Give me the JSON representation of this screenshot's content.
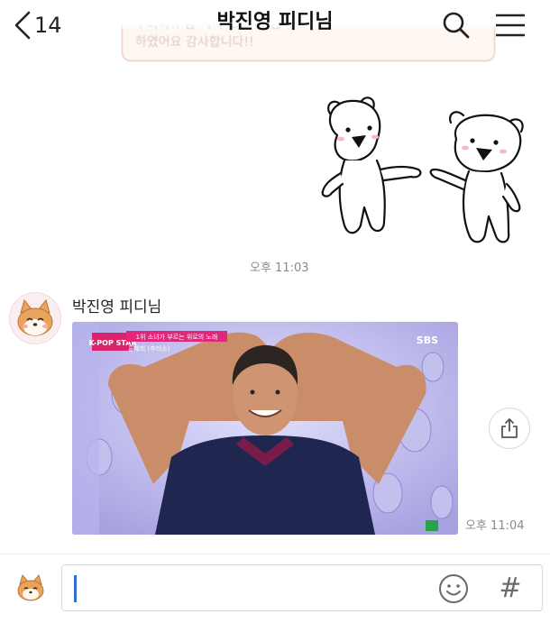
{
  "header": {
    "back_count": "14",
    "title": "박진영 피디님",
    "icons": [
      "chevron-left-icon",
      "search-icon",
      "menu-icon"
    ]
  },
  "notice": {
    "line1": "우와아!! 감     서서 오늘 참 감      주",
    "line2": "하였어요 감사합니다!!"
  },
  "messages": {
    "sticker_time": "오후 11:03",
    "friend": {
      "sender": "박진영 피디님",
      "photo_caption": "1위 소녀가 부르는 위로의 노래",
      "photo_sub": "홍혜희 (추리소)",
      "broadcaster": "SBS",
      "show_logo": "K-POP STAR",
      "time": "오후 11:04"
    }
  },
  "input": {
    "value": "",
    "placeholder": "",
    "hash_label": "#"
  }
}
